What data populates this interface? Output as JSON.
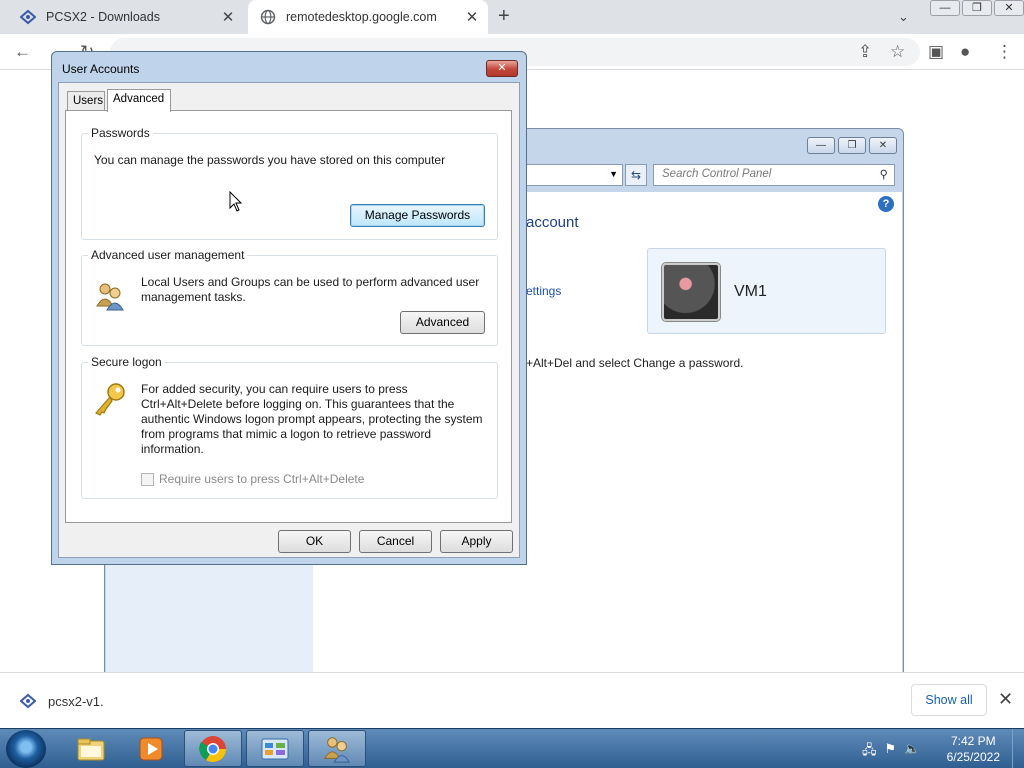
{
  "browser": {
    "tabs": [
      {
        "title": "PCSX2 - Downloads",
        "active": false
      },
      {
        "title": "remotedesktop.google.com",
        "active": true
      }
    ],
    "new_tab_label": "+",
    "close_glyph": "✕"
  },
  "control_panel": {
    "search_placeholder": "Search Control Panel",
    "heading_fragment": "account",
    "link_fragment": "ettings",
    "hint_fragment": "+Alt+Del and select Change a password.",
    "account_name": "VM1",
    "help_glyph": "?"
  },
  "dialog": {
    "title": "User Accounts",
    "tabs": {
      "users": "Users",
      "advanced": "Advanced"
    },
    "passwords": {
      "legend": "Passwords",
      "text": "You can manage the passwords you have stored on this computer",
      "button": "Manage Passwords"
    },
    "advanced_mgmt": {
      "legend": "Advanced user management",
      "text": "Local Users and Groups can be used to perform advanced user management tasks.",
      "button": "Advanced"
    },
    "secure_logon": {
      "legend": "Secure logon",
      "text": "For added security, you can require users to press Ctrl+Alt+Delete before logging on. This guarantees that the authentic Windows logon prompt appears, protecting the system from programs that mimic a logon to retrieve password information.",
      "checkbox_label": "Require users to press Ctrl+Alt+Delete",
      "checked": false
    },
    "buttons": {
      "ok": "OK",
      "cancel": "Cancel",
      "apply": "Apply"
    }
  },
  "downloads": {
    "file": "pcsx2-v1.",
    "show_all": "Show all"
  },
  "taskbar": {
    "time": "7:42 PM",
    "date": "6/25/2022"
  },
  "colors": {
    "dialog_frame": "#bfd3ea",
    "close_red": "#c2463a",
    "taskbar": "#2f5f92",
    "link_blue": "#1e4fa0"
  }
}
